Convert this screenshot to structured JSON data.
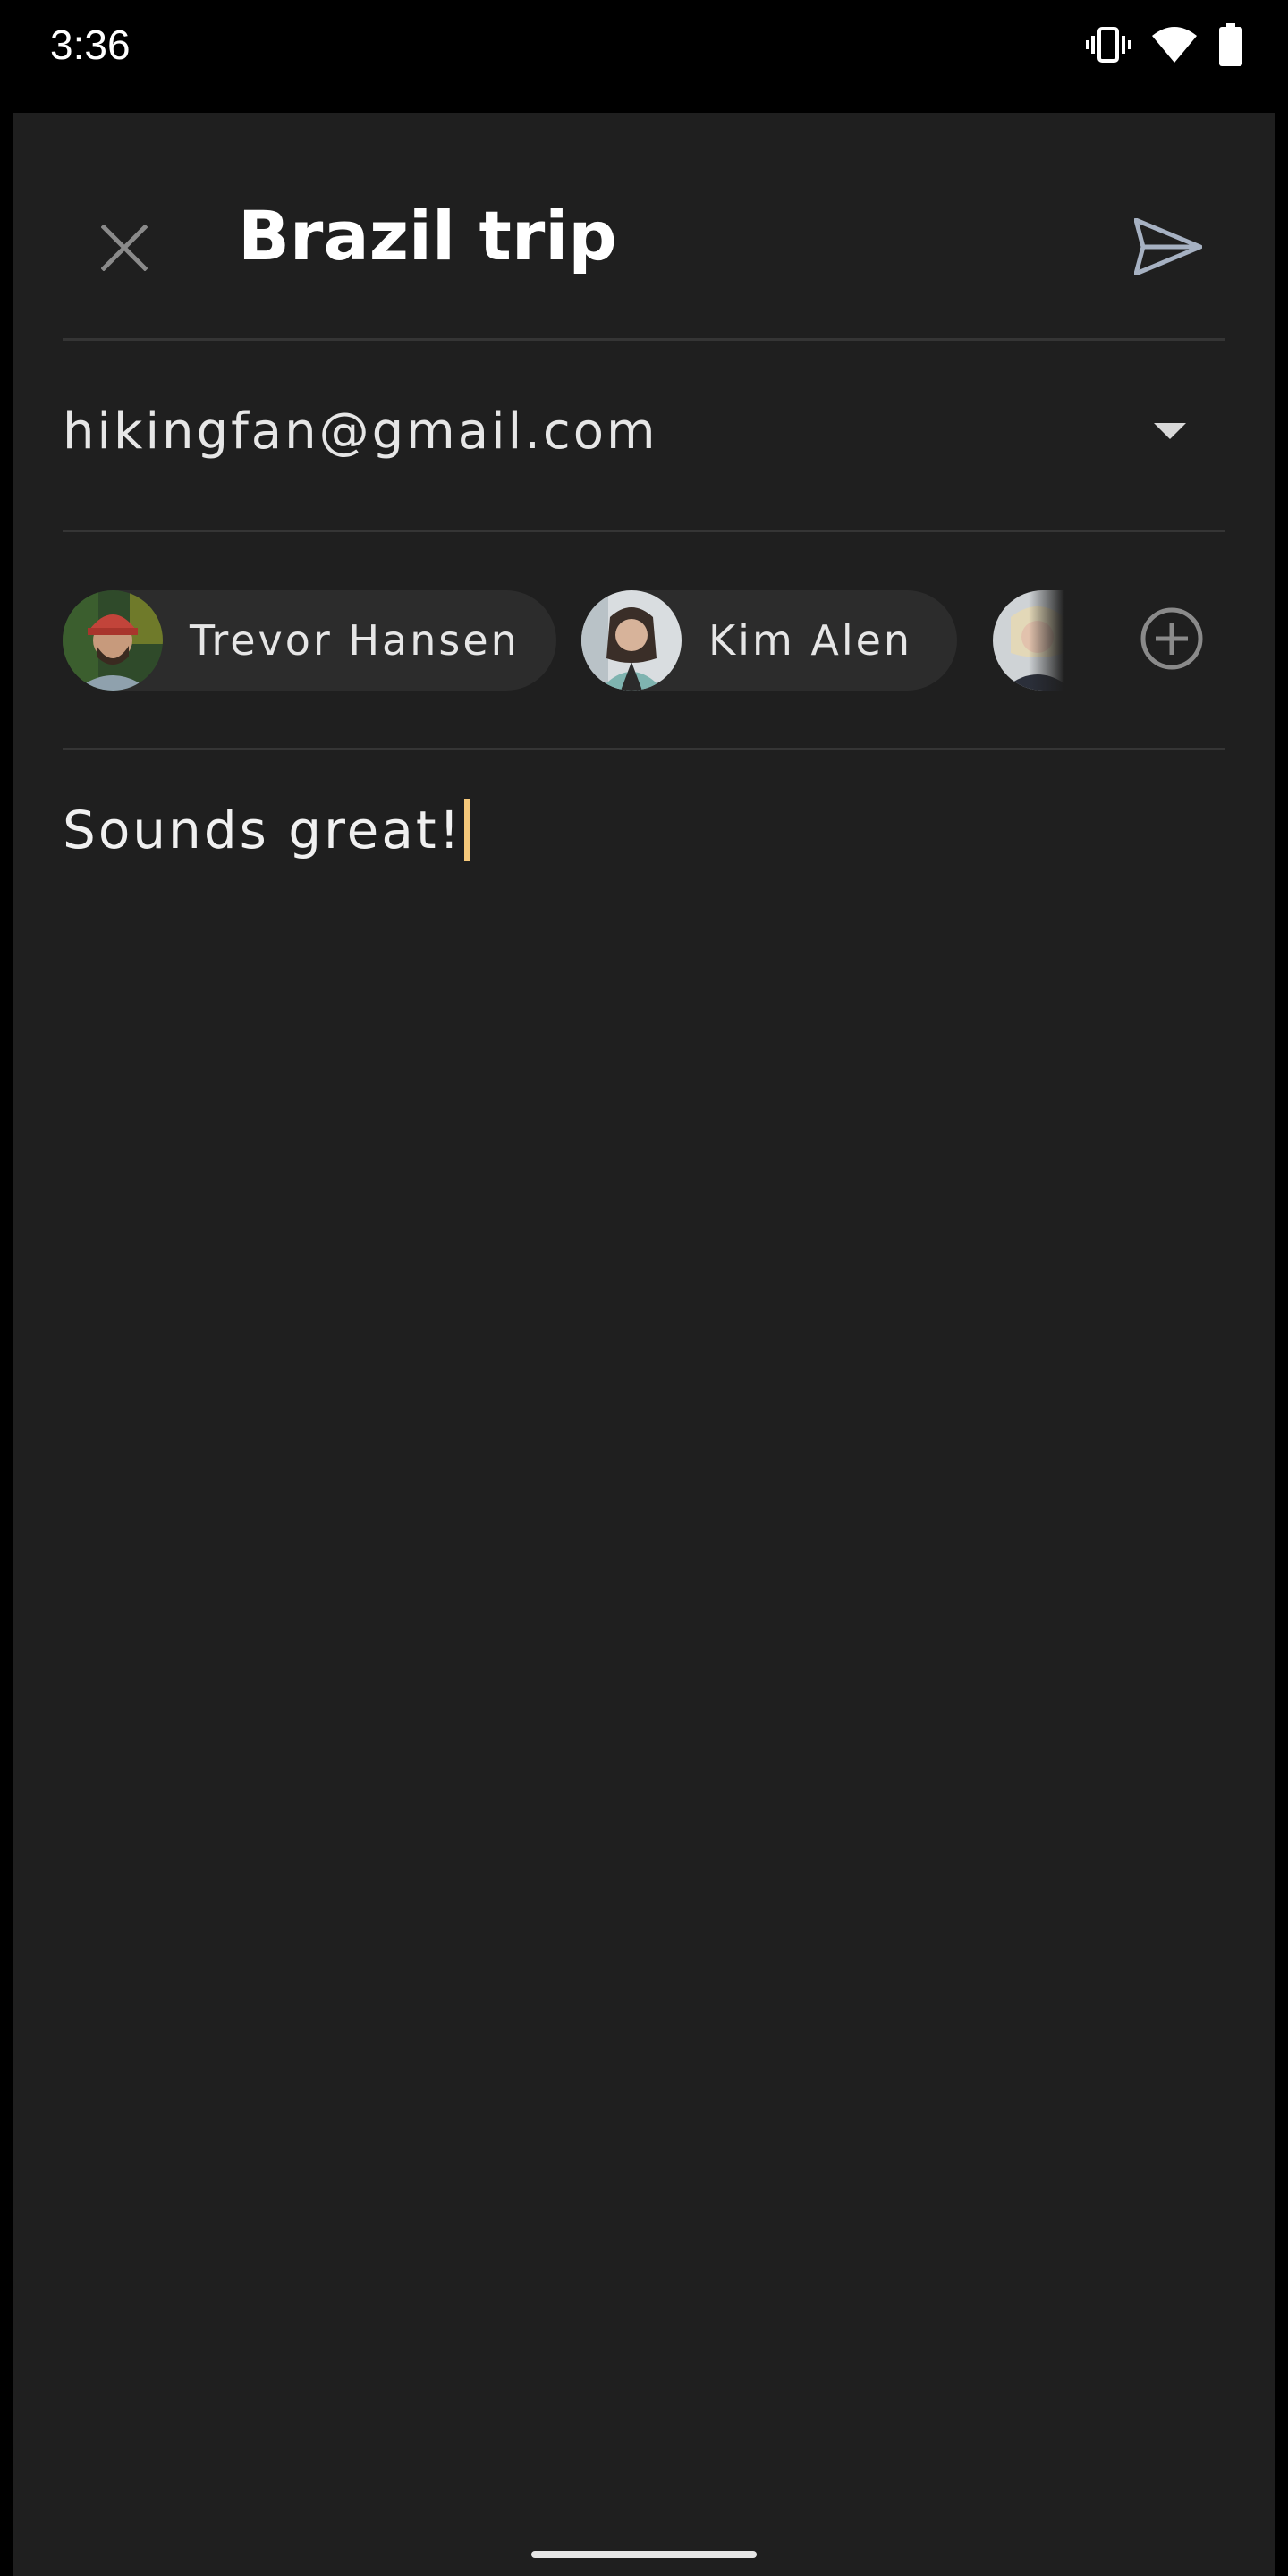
{
  "status_bar": {
    "time": "3:36",
    "icons": [
      "vibrate-icon",
      "wifi-icon",
      "battery-icon"
    ]
  },
  "header": {
    "close_icon": "close-icon",
    "title": "Brazil trip",
    "send_icon": "send-icon"
  },
  "from": {
    "email": "hikingfan@gmail.com",
    "dropdown_icon": "arrow-drop-down-icon"
  },
  "recipients": {
    "chips": [
      {
        "name": "Trevor Hansen",
        "avatar": "avatar-trevor"
      },
      {
        "name": "Kim Alen",
        "avatar": "avatar-kim"
      }
    ],
    "partial_chip_avatar": "avatar-third",
    "add_icon": "add-circle-icon"
  },
  "message": {
    "body": "Sounds great!"
  },
  "colors": {
    "background": "#1f1f1f",
    "status_bar": "#000000",
    "chip": "#2c2c2c",
    "divider": "#353535",
    "icon_gray": "#8a8a8a",
    "send_icon": "#a6b1c2",
    "cursor": "#f5c87a"
  }
}
